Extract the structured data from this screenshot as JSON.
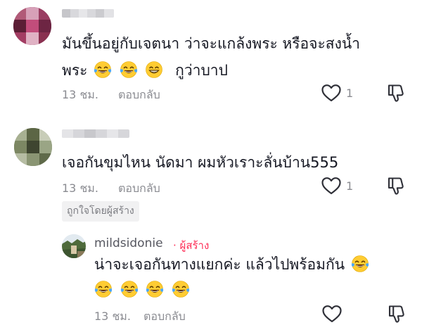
{
  "comments": [
    {
      "text_line1": "มันขึ้นอยู่กับเจตนา ว่าจะแกล้งพระ หรือจะสงน้ำ",
      "text_line2": "พระ",
      "text_line2_after": "กูว่าบาป",
      "emojis_line2": [
        "face-with-tears-of-joy-emoji",
        "face-with-tears-of-joy-emoji",
        "grinning-face-emoji"
      ],
      "time": "13 ชม.",
      "reply_label": "ตอบกลับ",
      "like_count": "1"
    },
    {
      "text_line1": "เจอกันขุมไหน นัดมา ผมหัวเราะลั่นบ้าน555",
      "time": "13 ชม.",
      "reply_label": "ตอบกลับ",
      "like_count": "1",
      "badge": "ถูกใจโดยผู้สร้าง"
    }
  ],
  "reply": {
    "username": "mildsidonie",
    "creator_tag": "· ผู้สร้าง",
    "text_line1": "น่าจะเจอกันทางแยกค่ะ แล้วไปพร้อมกัน",
    "emojis_line1": [
      "face-with-tears-of-joy-emoji"
    ],
    "emojis_line2": [
      "face-with-tears-of-joy-emoji",
      "face-with-tears-of-joy-emoji",
      "face-with-tears-of-joy-emoji",
      "face-with-tears-of-joy-emoji"
    ],
    "time": "13 ชม.",
    "reply_label": "ตอบกลับ"
  },
  "colors": {
    "text": "#161823",
    "meta": "#8a8b91",
    "creator": "#fe2c55",
    "badge_bg": "#f1f1f2"
  }
}
